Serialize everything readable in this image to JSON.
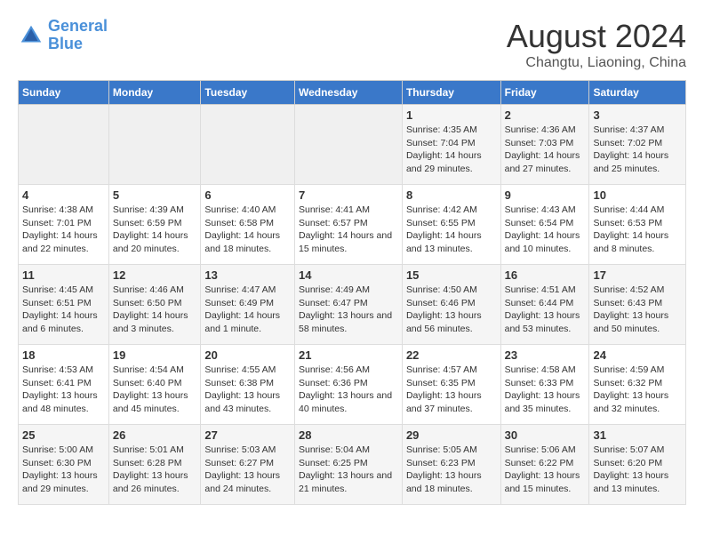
{
  "logo": {
    "line1": "General",
    "line2": "Blue"
  },
  "title": "August 2024",
  "subtitle": "Changtu, Liaoning, China",
  "weekdays": [
    "Sunday",
    "Monday",
    "Tuesday",
    "Wednesday",
    "Thursday",
    "Friday",
    "Saturday"
  ],
  "rows": [
    [
      {
        "day": "",
        "content": ""
      },
      {
        "day": "",
        "content": ""
      },
      {
        "day": "",
        "content": ""
      },
      {
        "day": "",
        "content": ""
      },
      {
        "day": "1",
        "content": "Sunrise: 4:35 AM\nSunset: 7:04 PM\nDaylight: 14 hours\nand 29 minutes."
      },
      {
        "day": "2",
        "content": "Sunrise: 4:36 AM\nSunset: 7:03 PM\nDaylight: 14 hours\nand 27 minutes."
      },
      {
        "day": "3",
        "content": "Sunrise: 4:37 AM\nSunset: 7:02 PM\nDaylight: 14 hours\nand 25 minutes."
      }
    ],
    [
      {
        "day": "4",
        "content": "Sunrise: 4:38 AM\nSunset: 7:01 PM\nDaylight: 14 hours\nand 22 minutes."
      },
      {
        "day": "5",
        "content": "Sunrise: 4:39 AM\nSunset: 6:59 PM\nDaylight: 14 hours\nand 20 minutes."
      },
      {
        "day": "6",
        "content": "Sunrise: 4:40 AM\nSunset: 6:58 PM\nDaylight: 14 hours\nand 18 minutes."
      },
      {
        "day": "7",
        "content": "Sunrise: 4:41 AM\nSunset: 6:57 PM\nDaylight: 14 hours\nand 15 minutes."
      },
      {
        "day": "8",
        "content": "Sunrise: 4:42 AM\nSunset: 6:55 PM\nDaylight: 14 hours\nand 13 minutes."
      },
      {
        "day": "9",
        "content": "Sunrise: 4:43 AM\nSunset: 6:54 PM\nDaylight: 14 hours\nand 10 minutes."
      },
      {
        "day": "10",
        "content": "Sunrise: 4:44 AM\nSunset: 6:53 PM\nDaylight: 14 hours\nand 8 minutes."
      }
    ],
    [
      {
        "day": "11",
        "content": "Sunrise: 4:45 AM\nSunset: 6:51 PM\nDaylight: 14 hours\nand 6 minutes."
      },
      {
        "day": "12",
        "content": "Sunrise: 4:46 AM\nSunset: 6:50 PM\nDaylight: 14 hours\nand 3 minutes."
      },
      {
        "day": "13",
        "content": "Sunrise: 4:47 AM\nSunset: 6:49 PM\nDaylight: 14 hours\nand 1 minute."
      },
      {
        "day": "14",
        "content": "Sunrise: 4:49 AM\nSunset: 6:47 PM\nDaylight: 13 hours\nand 58 minutes."
      },
      {
        "day": "15",
        "content": "Sunrise: 4:50 AM\nSunset: 6:46 PM\nDaylight: 13 hours\nand 56 minutes."
      },
      {
        "day": "16",
        "content": "Sunrise: 4:51 AM\nSunset: 6:44 PM\nDaylight: 13 hours\nand 53 minutes."
      },
      {
        "day": "17",
        "content": "Sunrise: 4:52 AM\nSunset: 6:43 PM\nDaylight: 13 hours\nand 50 minutes."
      }
    ],
    [
      {
        "day": "18",
        "content": "Sunrise: 4:53 AM\nSunset: 6:41 PM\nDaylight: 13 hours\nand 48 minutes."
      },
      {
        "day": "19",
        "content": "Sunrise: 4:54 AM\nSunset: 6:40 PM\nDaylight: 13 hours\nand 45 minutes."
      },
      {
        "day": "20",
        "content": "Sunrise: 4:55 AM\nSunset: 6:38 PM\nDaylight: 13 hours\nand 43 minutes."
      },
      {
        "day": "21",
        "content": "Sunrise: 4:56 AM\nSunset: 6:36 PM\nDaylight: 13 hours\nand 40 minutes."
      },
      {
        "day": "22",
        "content": "Sunrise: 4:57 AM\nSunset: 6:35 PM\nDaylight: 13 hours\nand 37 minutes."
      },
      {
        "day": "23",
        "content": "Sunrise: 4:58 AM\nSunset: 6:33 PM\nDaylight: 13 hours\nand 35 minutes."
      },
      {
        "day": "24",
        "content": "Sunrise: 4:59 AM\nSunset: 6:32 PM\nDaylight: 13 hours\nand 32 minutes."
      }
    ],
    [
      {
        "day": "25",
        "content": "Sunrise: 5:00 AM\nSunset: 6:30 PM\nDaylight: 13 hours\nand 29 minutes."
      },
      {
        "day": "26",
        "content": "Sunrise: 5:01 AM\nSunset: 6:28 PM\nDaylight: 13 hours\nand 26 minutes."
      },
      {
        "day": "27",
        "content": "Sunrise: 5:03 AM\nSunset: 6:27 PM\nDaylight: 13 hours\nand 24 minutes."
      },
      {
        "day": "28",
        "content": "Sunrise: 5:04 AM\nSunset: 6:25 PM\nDaylight: 13 hours\nand 21 minutes."
      },
      {
        "day": "29",
        "content": "Sunrise: 5:05 AM\nSunset: 6:23 PM\nDaylight: 13 hours\nand 18 minutes."
      },
      {
        "day": "30",
        "content": "Sunrise: 5:06 AM\nSunset: 6:22 PM\nDaylight: 13 hours\nand 15 minutes."
      },
      {
        "day": "31",
        "content": "Sunrise: 5:07 AM\nSunset: 6:20 PM\nDaylight: 13 hours\nand 13 minutes."
      }
    ]
  ]
}
